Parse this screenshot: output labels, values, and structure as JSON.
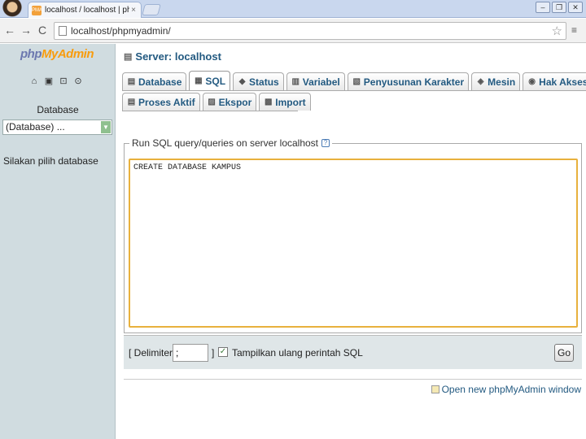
{
  "browser": {
    "tab_title": "localhost / localhost | phpMy",
    "tab_favicon": "PMA",
    "tab_close": "×",
    "url": "localhost/phpmyadmin/",
    "back": "←",
    "forward": "→",
    "reload": "C",
    "star": "☆",
    "wrench": "≡",
    "win_min": "–",
    "win_max": "❐",
    "win_close": "✕"
  },
  "sidebar": {
    "logo_php": "php",
    "logo_myadmin": "MyAdmin",
    "icons": [
      "home-icon",
      "exit-icon",
      "query-icon",
      "docs-icon"
    ],
    "icon_glyphs": [
      "⌂",
      "▣",
      "⊡",
      "⊙"
    ],
    "database_label": "Database",
    "database_select": "(Database) ...",
    "select_arrow": "▼",
    "choose_db_text": "Silakan pilih database"
  },
  "main": {
    "server_label": "Server: localhost",
    "server_icon": "▤",
    "tabs_row1": [
      {
        "label": "Database",
        "icon": "▤"
      },
      {
        "label": "SQL",
        "icon": "▦",
        "active": true
      },
      {
        "label": "Status",
        "icon": "◆"
      },
      {
        "label": "Variabel",
        "icon": "▥"
      },
      {
        "label": "Penyusunan Karakter",
        "icon": "▧"
      },
      {
        "label": "Mesin",
        "icon": "◈"
      },
      {
        "label": "Hak Akses",
        "icon": "◉"
      }
    ],
    "tabs_row2": [
      {
        "label": "Proses Aktif",
        "icon": "▤"
      },
      {
        "label": "Ekspor",
        "icon": "▨"
      },
      {
        "label": "Import",
        "icon": "▩"
      }
    ],
    "sql_legend": "Run SQL query/queries on server localhost",
    "help_icon": "?",
    "sql_query": "CREATE DATABASE KAMPUS",
    "delimiter_label": "[ Delimiter",
    "delimiter_value": ";",
    "bracket_close": "]",
    "checkbox_glyph": "✓",
    "show_query_label": "Tampilkan ulang perintah SQL",
    "go_button": "Go",
    "open_new_window": "Open new phpMyAdmin window"
  },
  "colors": {
    "accent_link": "#235a81",
    "sidebar_bg": "#d0dce0",
    "textarea_border": "#e8b13d"
  }
}
